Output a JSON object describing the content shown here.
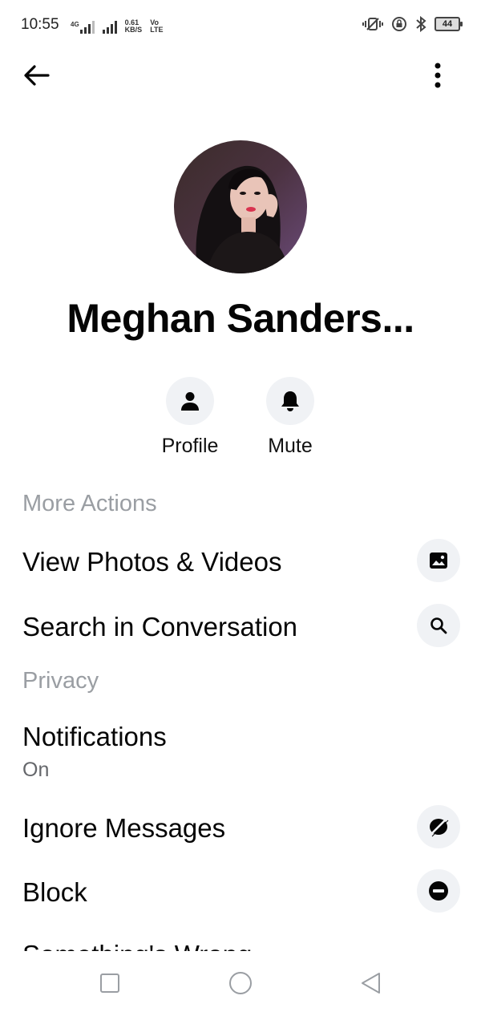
{
  "status_bar": {
    "time": "10:55",
    "network_4g": "4G",
    "data_rate": "0.61",
    "data_unit": "KB/S",
    "volte": "Vo",
    "lte": "LTE",
    "battery": "44"
  },
  "header": {
    "back_icon": "arrow-left-icon",
    "more_icon": "more-vertical-icon"
  },
  "profile": {
    "name": "Meghan Sanders..."
  },
  "quick_actions": [
    {
      "label": "Profile",
      "icon": "person-icon"
    },
    {
      "label": "Mute",
      "icon": "bell-icon"
    }
  ],
  "sections": {
    "more_actions": {
      "title": "More Actions",
      "items": [
        {
          "label": "View Photos & Videos",
          "icon": "image-icon"
        },
        {
          "label": "Search in Conversation",
          "icon": "search-icon"
        }
      ]
    },
    "privacy": {
      "title": "Privacy",
      "notifications": {
        "label": "Notifications",
        "value": "On"
      },
      "items": [
        {
          "label": "Ignore Messages",
          "icon": "ignore-icon"
        },
        {
          "label": "Block",
          "icon": "block-icon"
        },
        {
          "label": "Something's Wrong"
        }
      ]
    }
  },
  "colors": {
    "icon_bg": "#f0f2f5",
    "section_title": "#9a9ea3",
    "text": "#050505"
  }
}
